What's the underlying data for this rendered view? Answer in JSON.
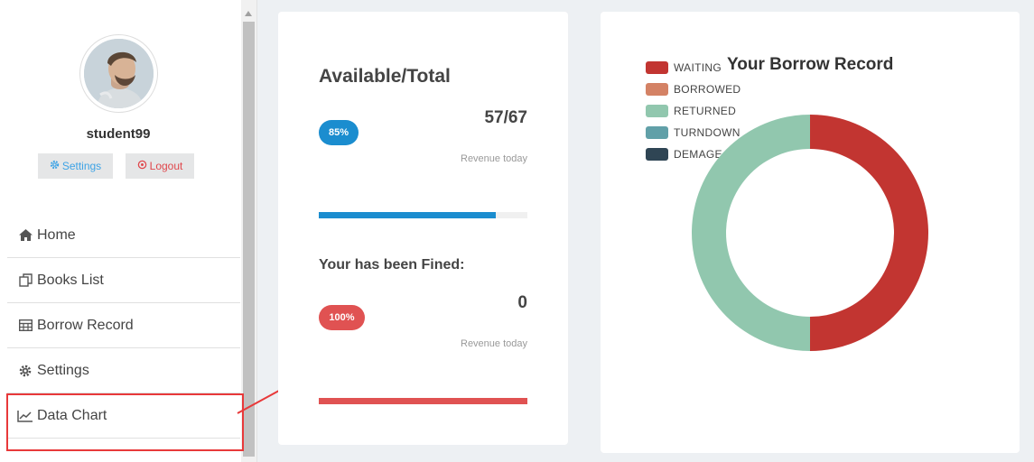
{
  "sidebar": {
    "username": "student99",
    "settings_button": "Settings",
    "logout_button": "Logout",
    "nav": [
      {
        "label": "Home",
        "icon": "home-icon"
      },
      {
        "label": "Books List",
        "icon": "clone-icon"
      },
      {
        "label": "Borrow Record",
        "icon": "table-icon"
      },
      {
        "label": "Settings",
        "icon": "gear-icon"
      },
      {
        "label": "Data Chart",
        "icon": "line-chart-icon"
      }
    ]
  },
  "stats": {
    "title": "Available/Total",
    "available_badge": "85%",
    "available_value": "57/67",
    "available_caption": "Revenue today",
    "available_progress": 0.85,
    "fined_title": "Your has been Fined:",
    "fined_badge": "100%",
    "fined_value": "0",
    "fined_caption": "Revenue today",
    "fined_progress": 1.0
  },
  "colors": {
    "primary": "#1b8dcf",
    "danger": "#e05252",
    "annotation_red": "#e8393a"
  },
  "chart_data": {
    "type": "pie",
    "title": "Your Borrow Record",
    "donut": true,
    "legend_position": "top-left",
    "categories": [
      "WAITING",
      "BORROWED",
      "RETURNED",
      "TURNDOWN",
      "DEMAGE"
    ],
    "values": [
      1,
      0,
      1,
      0,
      0
    ],
    "colors": [
      "#c23531",
      "#d48265",
      "#91c7ae",
      "#61a0a8",
      "#2f4554"
    ]
  }
}
